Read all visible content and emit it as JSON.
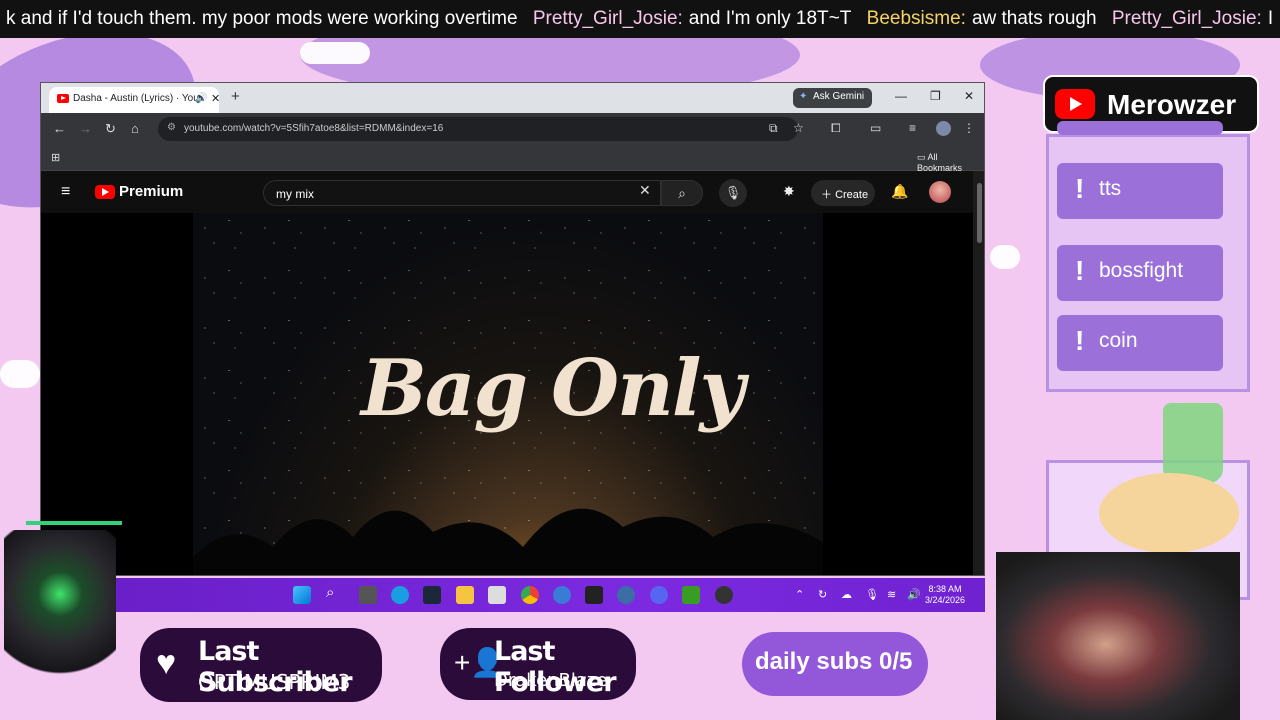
{
  "ticker": {
    "messages": [
      {
        "user": "",
        "user_color": "#ffffff",
        "text": "k and if I'd touch them. my poor mods were working overtime"
      },
      {
        "user": "Pretty_Girl_Josie:",
        "user_color": "#f7c6ec",
        "text": "and I'm only 18T~T"
      },
      {
        "user": "Beebsisme:",
        "user_color": "#f6d365",
        "text": "aw thats rough"
      },
      {
        "user": "Pretty_Girl_Josie:",
        "user_color": "#f7c6ec",
        "text": "I"
      }
    ]
  },
  "browser": {
    "tab_title": "Dasha - Austin (Lyrics) · You",
    "ask_gemini": "Ask Gemini",
    "url": "youtube.com/watch?v=5Sfih7atoe8&list=RDMM&index=16",
    "all_bookmarks": "All Bookmarks",
    "youtube": {
      "brand": "Premium",
      "search_value": "my mix",
      "create_label": "Create",
      "video_title_art": "Bag Only"
    }
  },
  "taskbar": {
    "time": "8:38 AM",
    "date": "3/24/2026"
  },
  "overlay": {
    "channel_name": "Merowzer",
    "commands": [
      "tts",
      "bossfight",
      "coin"
    ],
    "last_subscriber_label": "Last Subscriber",
    "last_subscriber_name": "OPTIMUSPRIM3",
    "last_follower_label": "Last Follower",
    "last_follower_name": "DrakenBlaze",
    "daily_subs": "daily subs 0/5"
  },
  "colors": {
    "overlay_bg": "#f3c9f1",
    "accent_purple": "#9b71d9",
    "taskbar": "#7c2ae0"
  }
}
